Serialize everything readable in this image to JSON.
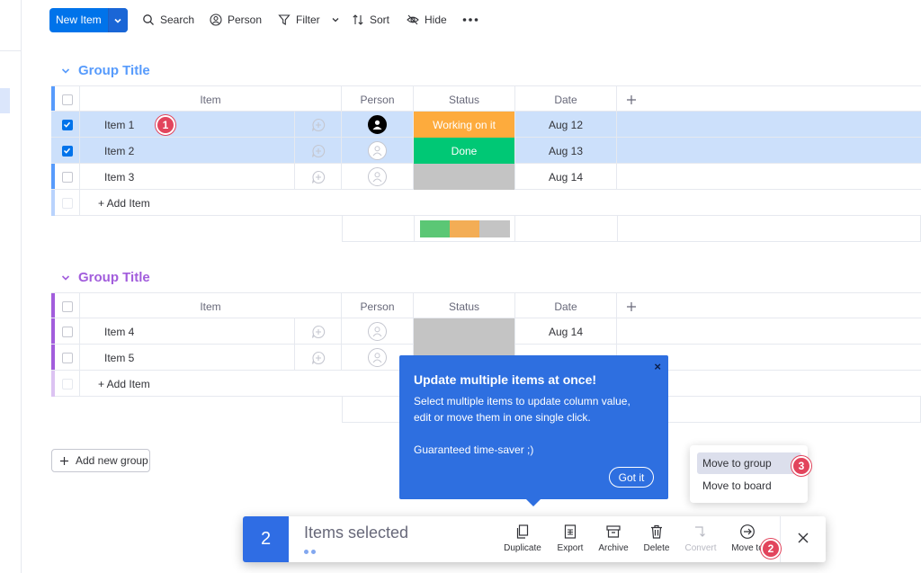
{
  "toolbar": {
    "new_item_label": "New Item",
    "search_label": "Search",
    "person_label": "Person",
    "filter_label": "Filter",
    "sort_label": "Sort",
    "hide_label": "Hide"
  },
  "groups": [
    {
      "title": "Group Title",
      "color": "#579bfc",
      "headers": {
        "item": "Item",
        "person": "Person",
        "status": "Status",
        "date": "Date"
      },
      "rows": [
        {
          "name": "Item 1",
          "checked": true,
          "status": "Working on it",
          "status_color": "#fdab3d",
          "date": "Aug 12",
          "person": "filled"
        },
        {
          "name": "Item 2",
          "checked": true,
          "status": "Done",
          "status_color": "#00c875",
          "date": "Aug 13",
          "person": "empty"
        },
        {
          "name": "Item 3",
          "checked": false,
          "status": "",
          "status_color": "#c4c4c4",
          "date": "Aug 14",
          "person": "empty"
        }
      ],
      "add_item_label": "+ Add Item",
      "status_summary": [
        {
          "color": "#5bc775",
          "fraction": 0.33
        },
        {
          "color": "#f3ad55",
          "fraction": 0.33
        },
        {
          "color": "#c4c4c4",
          "fraction": 0.34
        }
      ]
    },
    {
      "title": "Group Title",
      "color": "#a25ddc",
      "headers": {
        "item": "Item",
        "person": "Person",
        "status": "Status",
        "date": "Date"
      },
      "rows": [
        {
          "name": "Item 4",
          "checked": false,
          "status": "",
          "status_color": "#c4c4c4",
          "date": "Aug 14",
          "person": "empty"
        },
        {
          "name": "Item 5",
          "checked": false,
          "status": "",
          "status_color": "#c4c4c4",
          "date": "",
          "person": "empty"
        }
      ],
      "add_item_label": "+ Add Item"
    }
  ],
  "add_group_label": "Add new group",
  "tooltip": {
    "title": "Update multiple items at once!",
    "line1": "Select multiple items to update column value,",
    "line2": "edit or move them in one single click.",
    "line3": "Guaranteed time-saver ;)",
    "button": "Got it",
    "close": "×"
  },
  "move_menu": {
    "option1": "Move to group",
    "option2": "Move to board"
  },
  "action_bar": {
    "count": "2",
    "label": "Items selected",
    "duplicate": "Duplicate",
    "export": "Export",
    "archive": "Archive",
    "delete": "Delete",
    "convert": "Convert",
    "move_to": "Move to",
    "close": "×"
  },
  "step_badges": {
    "one": "1",
    "two": "2",
    "three": "3"
  },
  "colors": {
    "primary": "#0073ea",
    "tooltip": "#2e6fe0",
    "badge": "#e2445c"
  }
}
